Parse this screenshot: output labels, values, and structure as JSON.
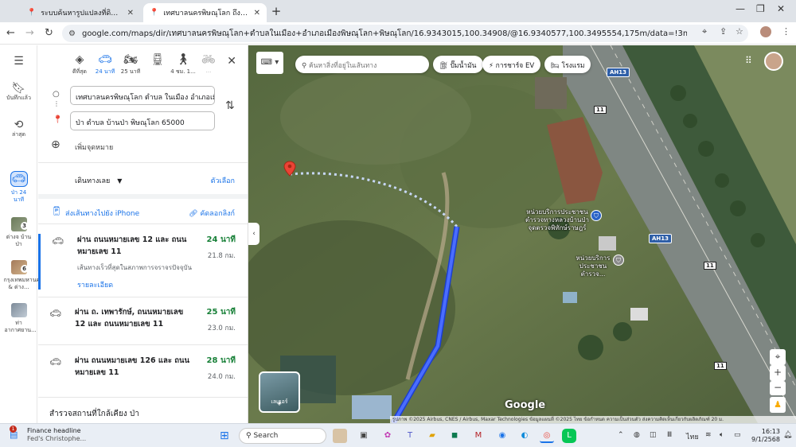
{
  "browser": {
    "tabs": [
      {
        "title": "ระบบค้นหารูปแปลงที่ดิน (LandsMa...",
        "active": false
      },
      {
        "title": "เทศบาลนครพิษณุโลก ถึง ป่า ตำบล บ...",
        "active": true
      }
    ],
    "url": "google.com/maps/dir/เทศบาลนครพิษณุโลก+ตำบลในเมือง+อำเภอเมืองพิษณุโลก+พิษณุโลก/16.9343015,100.34908/@16.9340577,100.3495554,175m/data=!3m1!1e3!4m9!4m8!1m5!1m1!1s0x30df97e77e746631:0x..."
  },
  "rail": {
    "items": [
      {
        "label": "บันทึกแล้ว",
        "icon": "bookmark-icon"
      },
      {
        "label": "ล่าสุด",
        "icon": "history-icon"
      },
      {
        "label": "ป่า 24 นาที",
        "icon": "car-icon",
        "selected": true
      },
      {
        "label": "ต่างจ บ้าน ป่า",
        "icon": "thumbnail",
        "badge": "3"
      },
      {
        "label": "กรุงเทพมหานคร & ต่าง...",
        "icon": "thumbnail",
        "badge": "6"
      },
      {
        "label": "ท่าอากาศยาน...",
        "icon": "thumbnail"
      }
    ]
  },
  "panel": {
    "modes": [
      {
        "label": "ดีที่สุด",
        "icon": "diamond-icon"
      },
      {
        "label": "24 นาที",
        "icon": "car-icon",
        "selected": true
      },
      {
        "label": "25 นาที",
        "icon": "motorcycle-icon"
      },
      {
        "label": "",
        "icon": "transit-icon"
      },
      {
        "label": "4 ชม. 1...",
        "icon": "walk-icon"
      },
      {
        "label": "...",
        "icon": "bicycle-icon"
      }
    ],
    "origin": "เทศบาลนครพิษณุโลก ตำบล ในเมือง อำเภอเมือ",
    "destination": "ป่า ตำบล บ้านป่า พิษณุโลก 65000",
    "add_stop": "เพิ่มจุดหมาย",
    "leave_now": "เดินทางเลย",
    "options": "ตัวเลือก",
    "send_to_phone": "ส่งเส้นทางไปยัง iPhone",
    "copy_link": "คัดลอกลิงก์",
    "routes": [
      {
        "via": "ผ่าน ถนนหมายเลข 12 และ ถนนหมายเลข 11",
        "duration": "24 นาที",
        "distance": "21.8 กม.",
        "note": "เส้นทางเร็วที่สุดในสภาพการจราจรปัจจุบัน",
        "details": "รายละเอียด",
        "selected": true
      },
      {
        "via": "ผ่าน ถ. เทพารักษ์, ถนนหมายเลข 12 และ ถนนหมายเลข 11",
        "duration": "25 นาที",
        "distance": "23.0 กม."
      },
      {
        "via": "ผ่าน ถนนหมายเลข 126 และ ถนนหมายเลข 11",
        "duration": "28 นาที",
        "distance": "24.0 กม."
      }
    ],
    "nearby": "สำรวจสถานที่ใกล้เคียง ป่า"
  },
  "map": {
    "search_placeholder": "ค้นหาสิ่งที่อยู่ในเส้นทาง",
    "chips": [
      {
        "label": "ปั๊มน้ำมัน",
        "icon": "gas-icon"
      },
      {
        "label": "การชาร์จ EV",
        "icon": "ev-icon"
      },
      {
        "label": "โรงแรม",
        "icon": "hotel-icon"
      }
    ],
    "road_ah13": "AH13",
    "road_11": "11",
    "poi1": "หน่วยบริการประชาชน ตำรวจทางหลวงบ้านป่า จุดตรวจพิทักษ์ราษฎร์",
    "poi2": "หน่วยบริการประชาชนตำรวจ...",
    "layers": "เลเยอร์",
    "logo": "Google",
    "attribution": "รูปภาพ ©2025 Airbus, CNES / Airbus, Maxar Technologies ข้อมูลแผนที่ ©2025   ไทย   ข้อกำหนด   ความเป็นส่วนตัว   ส่งความคิดเห็นเกี่ยวกับผลิตภัณฑ์   20 ม."
  },
  "taskbar": {
    "news_title": "Finance headline",
    "news_sub": "Fed's Christophe...",
    "news_badge": "1",
    "search": "Search",
    "lang": "ไทย",
    "time": "16:13",
    "date": "9/1/2568"
  }
}
